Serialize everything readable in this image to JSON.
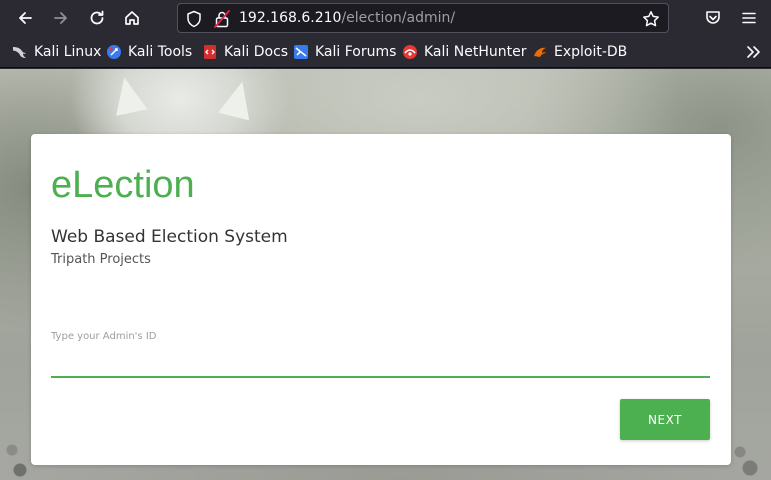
{
  "browser": {
    "url_host": "192.168.6.210",
    "url_path": "/election/admin/",
    "bookmarks": [
      {
        "label": "Kali Linux",
        "icon": "kali-dragon-icon"
      },
      {
        "label": "Kali Tools",
        "icon": "kali-tools-icon"
      },
      {
        "label": "Kali Docs",
        "icon": "kali-docs-icon"
      },
      {
        "label": "Kali Forums",
        "icon": "kali-forums-icon"
      },
      {
        "label": "Kali NetHunter",
        "icon": "kali-nethunter-icon"
      },
      {
        "label": "Exploit-DB",
        "icon": "exploit-db-icon"
      }
    ]
  },
  "login": {
    "brand": "eLection",
    "subtitle": "Web Based Election System",
    "company": "Tripath Projects",
    "admin_id_label": "Type your Admin's ID",
    "admin_id_value": "",
    "next_label": "NEXT"
  },
  "colors": {
    "accent": "#4caf50",
    "toolbar_bg": "#2b2a33",
    "urlbar_bg": "#1c1b22"
  }
}
